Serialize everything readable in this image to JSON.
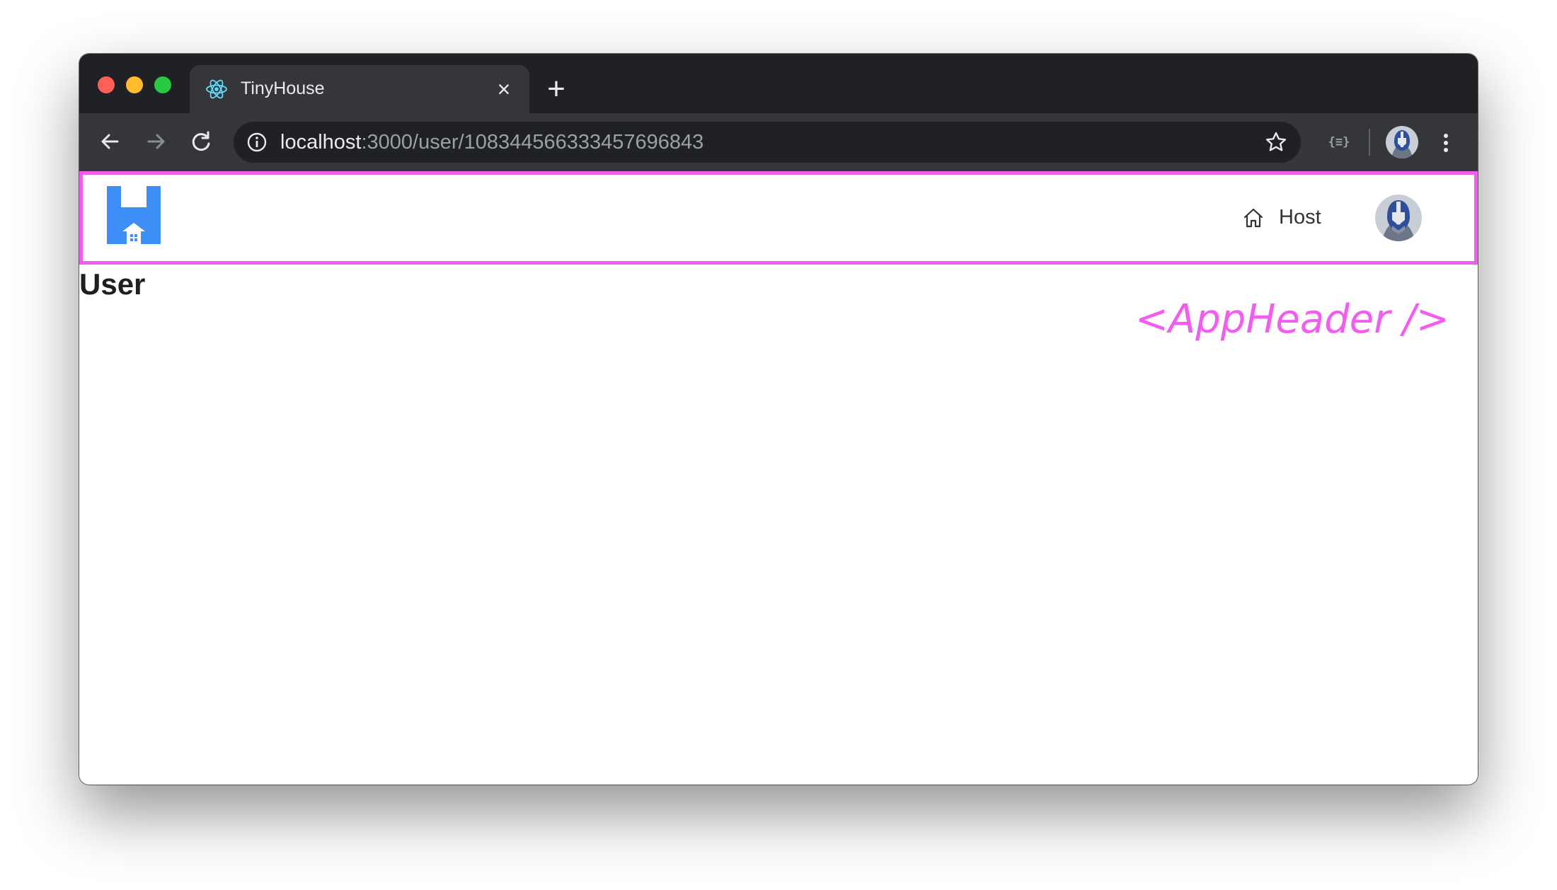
{
  "browser": {
    "tab": {
      "title": "TinyHouse",
      "favicon": "react-logo-icon",
      "close_icon": "close-icon"
    },
    "new_tab_icon": "plus-icon",
    "toolbar": {
      "back_icon": "arrow-left-icon",
      "forward_icon": "arrow-right-icon",
      "reload_icon": "reload-icon",
      "url_host": "localhost",
      "url_path": ":3000/user/108344566333457696843",
      "site_info_icon": "info-icon",
      "bookmark_icon": "star-icon",
      "extension_label": "{≡}",
      "profile_icon": "profile-avatar",
      "menu_icon": "kebab-menu-icon"
    }
  },
  "app": {
    "header": {
      "logo": "tinyhouse-logo",
      "host_label": "Host",
      "host_icon": "home-icon",
      "avatar": "user-avatar"
    },
    "page_title": "User"
  },
  "annotation": {
    "text": "<AppHeader />",
    "color": "#f25cf0"
  },
  "colors": {
    "annotation_border": "#f25cf0",
    "logo_blue": "#3d8ef7",
    "chrome_dark": "#202124",
    "chrome_toolbar": "#35363a"
  }
}
